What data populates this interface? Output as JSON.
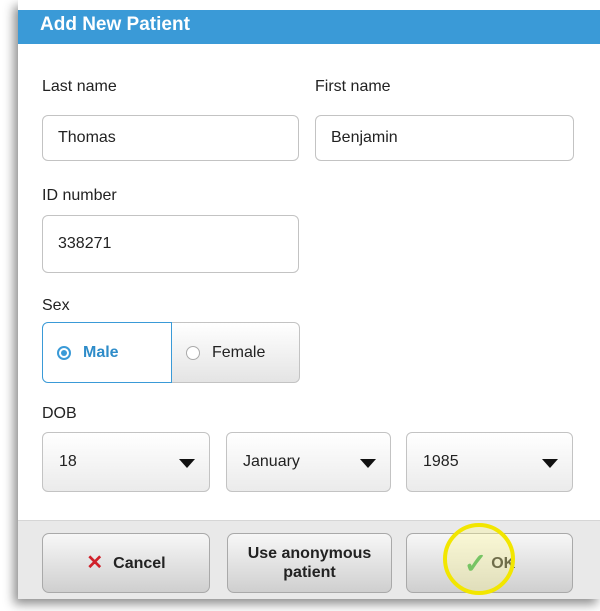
{
  "dialog": {
    "title": "Add New Patient"
  },
  "fields": {
    "last_name": {
      "label": "Last name",
      "value": "Thomas"
    },
    "first_name": {
      "label": "First name",
      "value": "Benjamin"
    },
    "id_number": {
      "label": "ID number",
      "value": "338271"
    }
  },
  "sex": {
    "label": "Sex",
    "options": [
      "Male",
      "Female"
    ],
    "selected": "Male"
  },
  "dob": {
    "label": "DOB",
    "day": "18",
    "month": "January",
    "year": "1985"
  },
  "buttons": {
    "cancel": "Cancel",
    "anonymous": "Use anonymous patient",
    "ok": "OK"
  },
  "colors": {
    "accent": "#3a9ad7",
    "cancel_icon": "#d0202a",
    "ok_icon": "#2ea84a",
    "highlight": "#f2e600"
  },
  "icons": {
    "cancel": "x-icon",
    "ok": "checkmark-icon",
    "dropdown": "caret-down-icon"
  }
}
